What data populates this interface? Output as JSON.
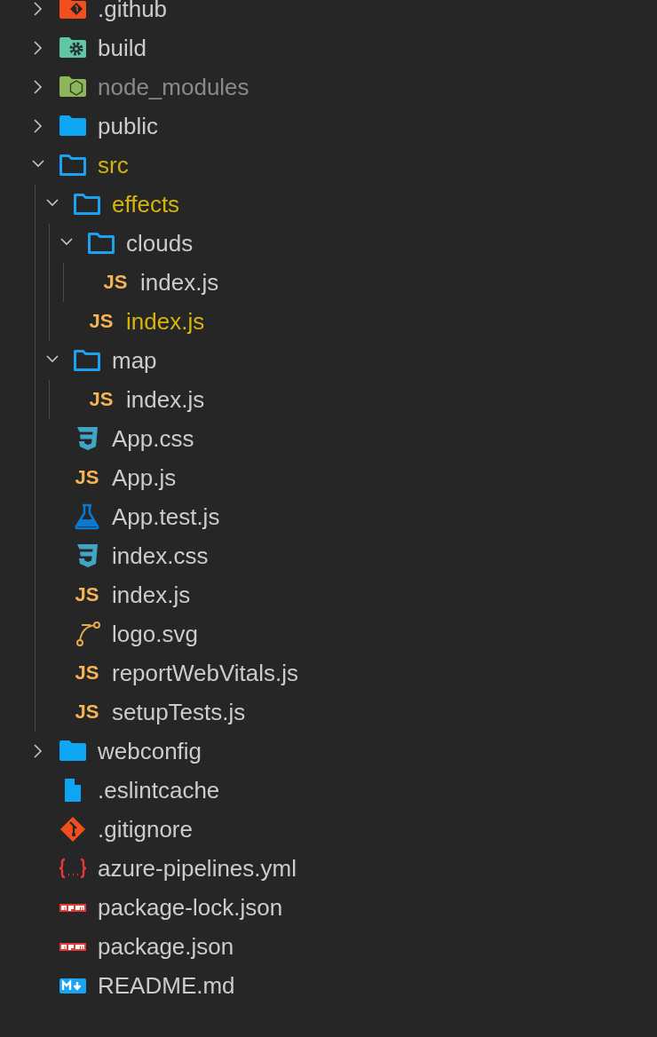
{
  "tree": [
    {
      "name": ".github",
      "kind": "git-folder",
      "expanded": false,
      "modified": false,
      "ignored": false
    },
    {
      "name": "build",
      "kind": "gear-folder",
      "expanded": false,
      "modified": false,
      "ignored": false
    },
    {
      "name": "node_modules",
      "kind": "node-folder",
      "expanded": false,
      "modified": false,
      "ignored": true
    },
    {
      "name": "public",
      "kind": "folder",
      "expanded": false,
      "modified": false,
      "ignored": false
    },
    {
      "name": "src",
      "kind": "folder",
      "expanded": true,
      "modified": true,
      "ignored": false,
      "children": [
        {
          "name": "effects",
          "kind": "folder",
          "expanded": true,
          "modified": true,
          "ignored": false,
          "children": [
            {
              "name": "clouds",
              "kind": "folder",
              "expanded": true,
              "modified": false,
              "ignored": false,
              "children": [
                {
                  "name": "index.js",
                  "kind": "js",
                  "icon_text": "JS",
                  "modified": false,
                  "ignored": false
                }
              ]
            },
            {
              "name": "index.js",
              "kind": "js",
              "icon_text": "JS",
              "modified": true,
              "ignored": false
            }
          ]
        },
        {
          "name": "map",
          "kind": "folder",
          "expanded": true,
          "modified": false,
          "ignored": false,
          "children": [
            {
              "name": "index.js",
              "kind": "js",
              "icon_text": "JS",
              "modified": false,
              "ignored": false
            }
          ]
        },
        {
          "name": "App.css",
          "kind": "css",
          "modified": false,
          "ignored": false
        },
        {
          "name": "App.js",
          "kind": "js",
          "icon_text": "JS",
          "modified": false,
          "ignored": false
        },
        {
          "name": "App.test.js",
          "kind": "test",
          "modified": false,
          "ignored": false
        },
        {
          "name": "index.css",
          "kind": "css",
          "modified": false,
          "ignored": false
        },
        {
          "name": "index.js",
          "kind": "js",
          "icon_text": "JS",
          "modified": false,
          "ignored": false
        },
        {
          "name": "logo.svg",
          "kind": "svg",
          "modified": false,
          "ignored": false
        },
        {
          "name": "reportWebVitals.js",
          "kind": "js",
          "icon_text": "JS",
          "modified": false,
          "ignored": false
        },
        {
          "name": "setupTests.js",
          "kind": "js",
          "icon_text": "JS",
          "modified": false,
          "ignored": false
        }
      ]
    },
    {
      "name": "webconfig",
      "kind": "folder",
      "expanded": false,
      "modified": false,
      "ignored": false
    },
    {
      "name": ".eslintcache",
      "kind": "file",
      "modified": false,
      "ignored": false
    },
    {
      "name": ".gitignore",
      "kind": "git",
      "modified": false,
      "ignored": false
    },
    {
      "name": "azure-pipelines.yml",
      "kind": "yml",
      "modified": false,
      "ignored": false
    },
    {
      "name": "package-lock.json",
      "kind": "npm",
      "modified": false,
      "ignored": false
    },
    {
      "name": "package.json",
      "kind": "npm",
      "modified": false,
      "ignored": false
    },
    {
      "name": "README.md",
      "kind": "markdown",
      "modified": false,
      "ignored": false
    }
  ]
}
